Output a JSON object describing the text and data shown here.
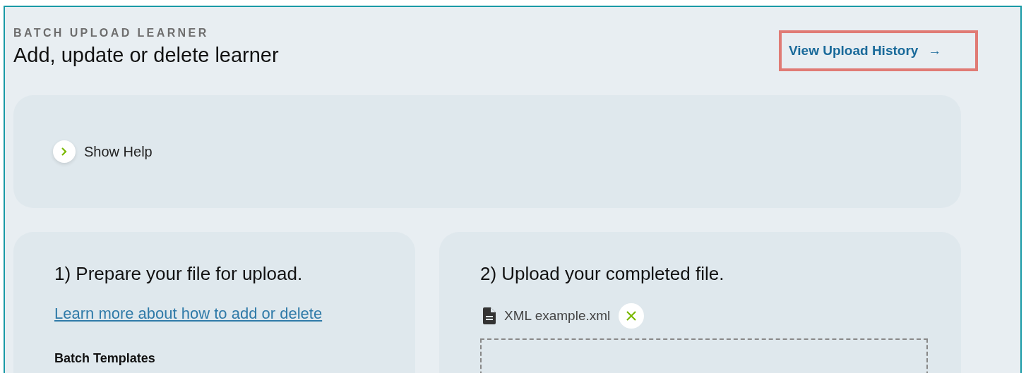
{
  "header": {
    "eyebrow": "BATCH UPLOAD LEARNER",
    "title": "Add, update or delete learner",
    "history_link": {
      "label": "View Upload History",
      "arrow": "→"
    }
  },
  "help": {
    "label": "Show Help",
    "expanded": false
  },
  "steps": [
    {
      "kind": "prepare",
      "title": "1) Prepare your file for upload.",
      "link": "Learn more about how to add or delete",
      "subheading": "Batch Templates"
    },
    {
      "kind": "upload",
      "title": "2) Upload your completed file.",
      "file_name": "XML example.xml"
    }
  ]
}
